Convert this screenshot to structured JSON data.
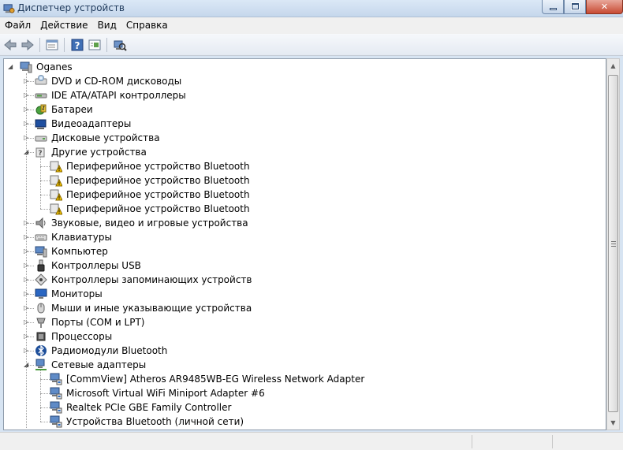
{
  "window": {
    "title": "Диспетчер устройств"
  },
  "menu": {
    "items": [
      "Файл",
      "Действие",
      "Вид",
      "Справка"
    ]
  },
  "toolbar": {
    "buttons": [
      "back-arrow-icon",
      "forward-arrow-icon",
      "properties-icon",
      "help-icon",
      "show-hidden-icon",
      "scan-hardware-icon"
    ]
  },
  "tree": {
    "root": "Oganes",
    "categories": [
      {
        "label": "DVD и CD-ROM дисководы",
        "icon": "dvd-drive-icon",
        "expanded": false
      },
      {
        "label": "IDE ATA/ATAPI контроллеры",
        "icon": "ide-controller-icon",
        "expanded": false
      },
      {
        "label": "Батареи",
        "icon": "battery-icon",
        "expanded": false
      },
      {
        "label": "Видеоадаптеры",
        "icon": "display-adapter-icon",
        "expanded": false
      },
      {
        "label": "Дисковые устройства",
        "icon": "disk-drive-icon",
        "expanded": false
      },
      {
        "label": "Другие устройства",
        "icon": "other-devices-icon",
        "expanded": true,
        "children": [
          {
            "label": "Периферийное устройство Bluetooth",
            "icon": "warning-device-icon"
          },
          {
            "label": "Периферийное устройство Bluetooth",
            "icon": "warning-device-icon"
          },
          {
            "label": "Периферийное устройство Bluetooth",
            "icon": "warning-device-icon"
          },
          {
            "label": "Периферийное устройство Bluetooth",
            "icon": "warning-device-icon"
          }
        ]
      },
      {
        "label": "Звуковые, видео и игровые устройства",
        "icon": "speaker-icon",
        "expanded": false
      },
      {
        "label": "Клавиатуры",
        "icon": "keyboard-icon",
        "expanded": false
      },
      {
        "label": "Компьютер",
        "icon": "computer-icon",
        "expanded": false
      },
      {
        "label": "Контроллеры USB",
        "icon": "usb-icon",
        "expanded": false
      },
      {
        "label": "Контроллеры запоминающих устройств",
        "icon": "storage-controller-icon",
        "expanded": false
      },
      {
        "label": "Мониторы",
        "icon": "monitor-icon",
        "expanded": false
      },
      {
        "label": "Мыши и иные указывающие устройства",
        "icon": "mouse-icon",
        "expanded": false
      },
      {
        "label": "Порты (COM и LPT)",
        "icon": "port-icon",
        "expanded": false
      },
      {
        "label": "Процессоры",
        "icon": "processor-icon",
        "expanded": false
      },
      {
        "label": "Радиомодули Bluetooth",
        "icon": "bluetooth-icon",
        "expanded": false
      },
      {
        "label": "Сетевые адаптеры",
        "icon": "network-adapter-icon",
        "expanded": true,
        "children": [
          {
            "label": "[CommView] Atheros AR9485WB-EG Wireless Network Adapter",
            "icon": "network-card-icon"
          },
          {
            "label": "Microsoft Virtual WiFi Miniport Adapter #6",
            "icon": "network-card-icon"
          },
          {
            "label": "Realtek PCIe GBE Family Controller",
            "icon": "network-card-icon"
          },
          {
            "label": "Устройства Bluetooth (личной сети)",
            "icon": "network-card-icon"
          }
        ]
      }
    ]
  },
  "colors": {
    "selection": "#3399ff",
    "warning": "#f2c200",
    "titlebar": "#c5d7ec"
  }
}
